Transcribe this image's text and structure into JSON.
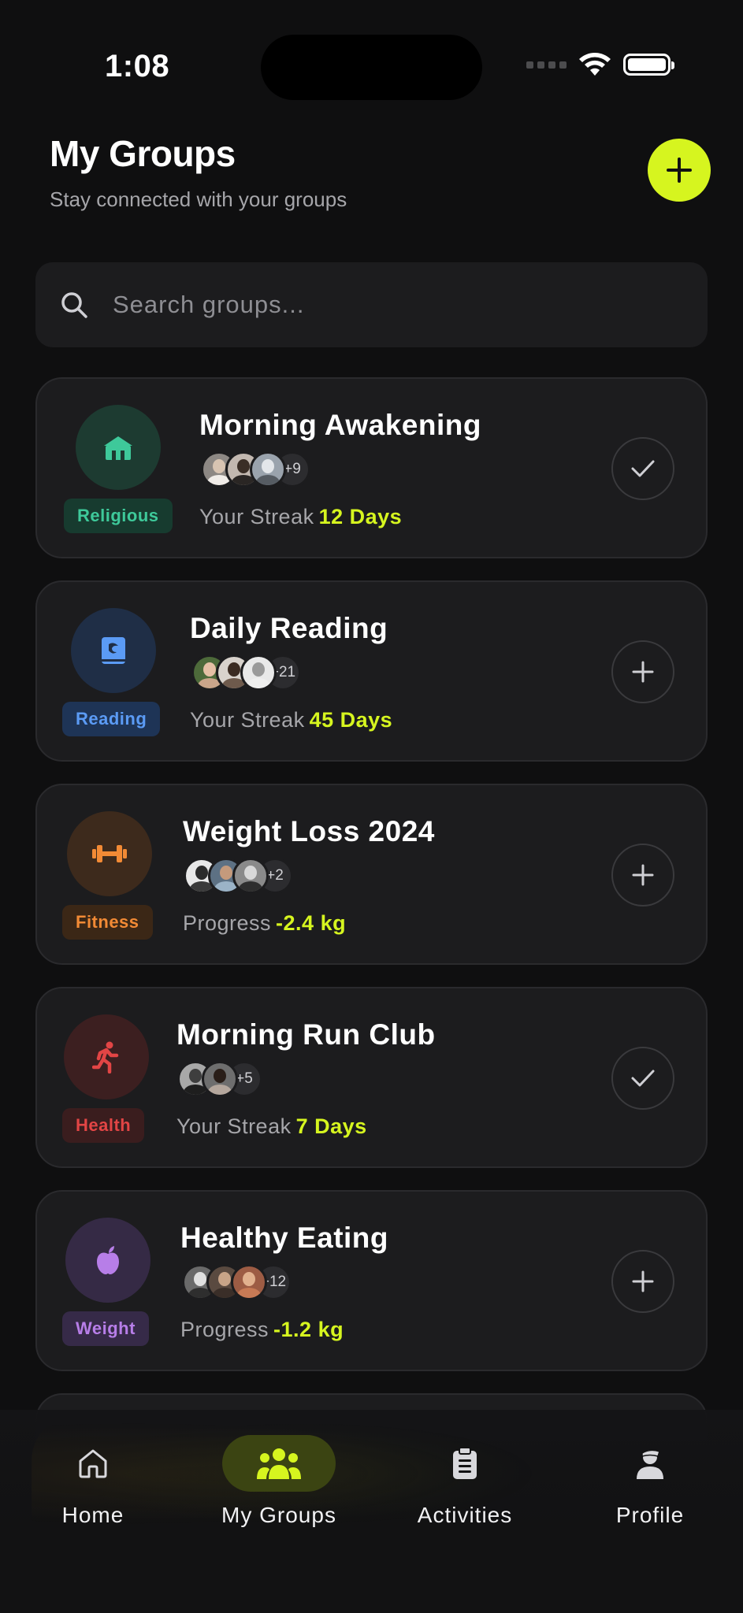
{
  "status_bar": {
    "time": "1:08"
  },
  "header": {
    "title": "My Groups",
    "subtitle": "Stay connected with your groups"
  },
  "search": {
    "placeholder": "Search groups..."
  },
  "groups": [
    {
      "name": "Morning Awakening",
      "category": "Religious",
      "icon": "mosque-icon",
      "accent": "#3ec99a",
      "more_members": "+9",
      "stat_label": "Your Streak",
      "stat_value": "12 Days",
      "action": "checked"
    },
    {
      "name": "Daily Reading",
      "category": "Reading",
      "icon": "book-icon",
      "accent": "#5b9bf5",
      "more_members": "+21",
      "stat_label": "Your Streak",
      "stat_value": "45 Days",
      "action": "join"
    },
    {
      "name": "Weight Loss 2024",
      "category": "Fitness",
      "icon": "dumbbell-icon",
      "accent": "#f28a35",
      "more_members": "+2",
      "stat_label": "Progress",
      "stat_value": "-2.4 kg",
      "action": "join"
    },
    {
      "name": "Morning Run Club",
      "category": "Health",
      "icon": "runner-icon",
      "accent": "#e24545",
      "more_members": "+5",
      "stat_label": "Your Streak",
      "stat_value": "7 Days",
      "action": "checked"
    },
    {
      "name": "Healthy Eating",
      "category": "Weight",
      "icon": "apple-icon",
      "accent": "#b77ee8",
      "more_members": "+12",
      "stat_label": "Progress",
      "stat_value": "-1.2 kg",
      "action": "join"
    }
  ],
  "nav": {
    "items": [
      {
        "label": "Home",
        "icon": "home-icon"
      },
      {
        "label": "My Groups",
        "icon": "groups-icon",
        "active": true
      },
      {
        "label": "Activities",
        "icon": "clipboard-icon"
      },
      {
        "label": "Profile",
        "icon": "profile-icon"
      }
    ]
  },
  "colors": {
    "accent": "#d6f51f",
    "background": "#0f0f10",
    "card": "#1c1c1e"
  }
}
